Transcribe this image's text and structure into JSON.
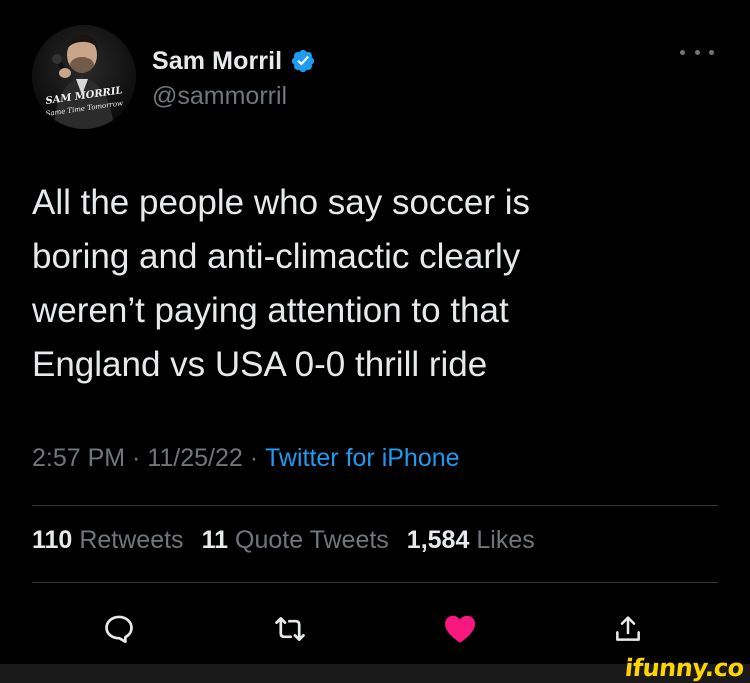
{
  "tweet": {
    "author": {
      "display_name": "Sam Morril",
      "handle": "@sammorril",
      "verified": true,
      "avatar_text": "SAM MORRIL",
      "avatar_subtext": "Same Time Tomorrow"
    },
    "text": "All the people who say soccer is\nboring and anti-climactic clearly\nweren’t paying attention to that\nEngland vs USA 0-0 thrill ride",
    "time": "2:57 PM",
    "date": "11/25/22",
    "source": "Twitter for iPhone",
    "separator": " · ",
    "stats": [
      {
        "count": "110",
        "label": "Retweets"
      },
      {
        "count": "11",
        "label": "Quote Tweets"
      },
      {
        "count": "1,584",
        "label": "Likes"
      }
    ],
    "actions": [
      "reply-icon",
      "retweet-icon",
      "like-icon",
      "share-icon"
    ],
    "liked": true
  },
  "watermark": "ifunny.co",
  "colors": {
    "background": "#000000",
    "primary_text": "#e7e9ea",
    "secondary_text": "#71767b",
    "link": "#1d9bf0",
    "like": "#f91880",
    "divider": "#2f3336"
  }
}
